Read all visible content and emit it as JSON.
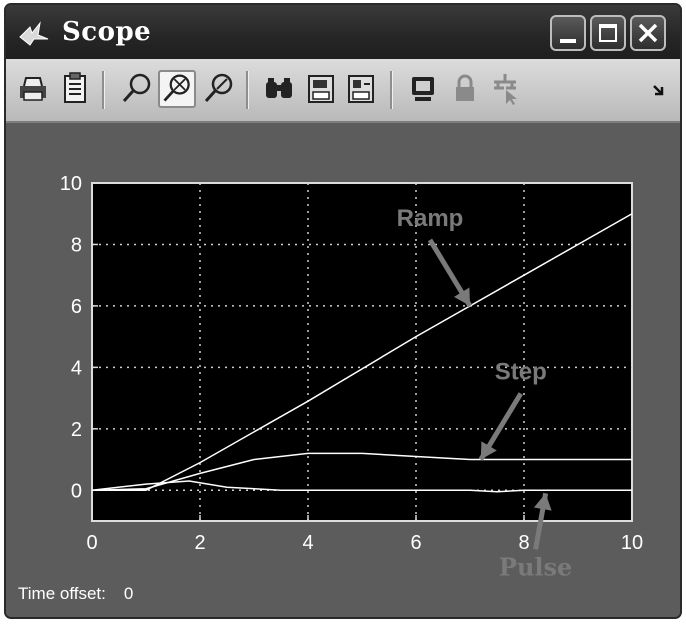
{
  "window": {
    "title": "Scope"
  },
  "toolbar": {
    "tools": [
      "print-icon",
      "parameters-icon",
      "zoom-icon",
      "zoom-x-icon",
      "zoom-y-icon",
      "autoscale-icon",
      "save-axes-icon",
      "restore-axes-icon",
      "floating-scope-icon",
      "lock-icon",
      "signal-selection-icon",
      "dock-arrow-icon"
    ],
    "pressed_tool": "zoom-x-icon"
  },
  "status": {
    "time_offset_label": "Time offset:",
    "time_offset_value": "0"
  },
  "colors": {
    "plot_background": "#000000",
    "window_background": "#5c5c5c",
    "trace": "#ffffff",
    "annotation": "#7a7a7a"
  },
  "chart_data": {
    "type": "line",
    "xlim": [
      0,
      10
    ],
    "ylim": [
      -1,
      10
    ],
    "xticks": [
      0,
      2,
      4,
      6,
      8,
      10
    ],
    "yticks": [
      0,
      2,
      4,
      6,
      8,
      10
    ],
    "grid": true,
    "series": [
      {
        "name": "Ramp",
        "x": [
          0,
          1,
          2,
          4,
          6,
          8,
          10
        ],
        "y": [
          0,
          0,
          0.9,
          2.9,
          5,
          7,
          9
        ]
      },
      {
        "name": "Step",
        "x": [
          0,
          1,
          2,
          3,
          4,
          5,
          6,
          7,
          8,
          10
        ],
        "y": [
          0,
          0.05,
          0.55,
          1.0,
          1.2,
          1.2,
          1.1,
          1.0,
          1.0,
          1.0
        ]
      },
      {
        "name": "Pulse",
        "x": [
          0,
          1,
          1.8,
          2.5,
          3.5,
          4,
          5,
          6,
          7,
          7.5,
          8,
          10
        ],
        "y": [
          0,
          0.2,
          0.3,
          0.1,
          0,
          0,
          0,
          0,
          0,
          -0.05,
          0,
          0
        ]
      }
    ],
    "annotations": [
      {
        "text": "Ramp",
        "target_x": 7,
        "target_y": 6
      },
      {
        "text": "Step",
        "target_x": 7.2,
        "target_y": 1.0
      },
      {
        "text": "Pulse",
        "target_x": 8.4,
        "target_y": -0.1
      }
    ]
  }
}
